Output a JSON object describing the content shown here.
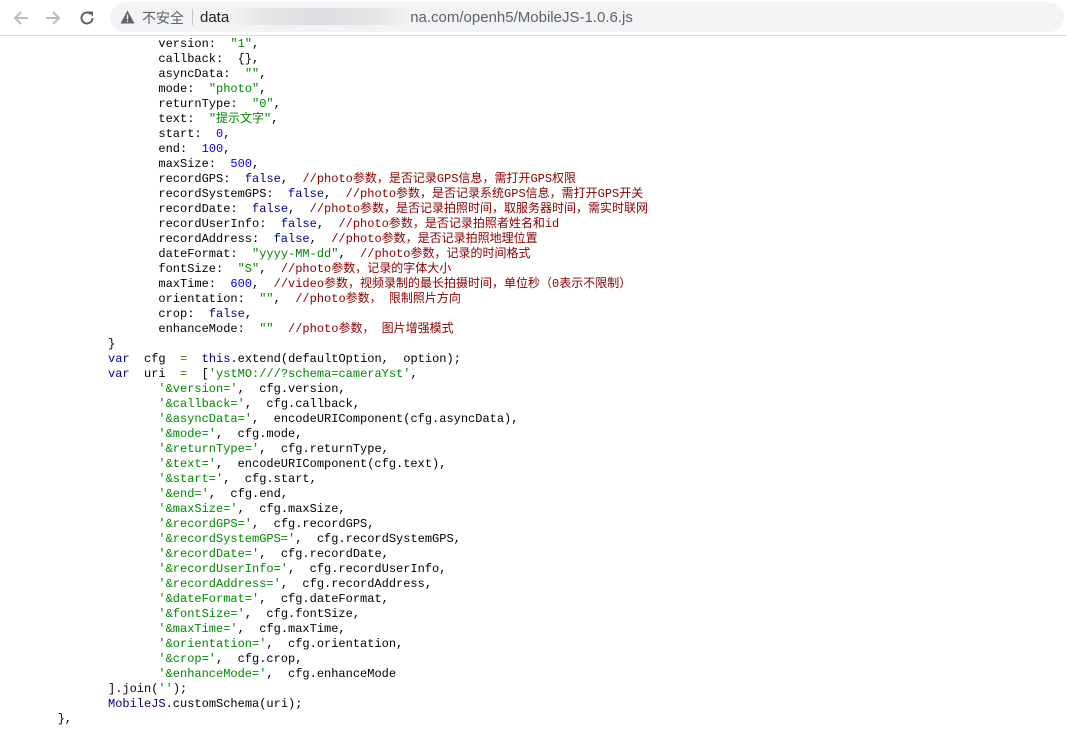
{
  "browser": {
    "security_label": "不安全",
    "url_prefix": "data",
    "url_suffix": "na.com/openh5/MobileJS-1.0.6.js"
  },
  "code_lines": [
    {
      "indent": 22,
      "tokens": [
        {
          "t": "p",
          "v": "version:  "
        },
        {
          "t": "s",
          "v": "\"1\""
        },
        {
          "t": "p",
          "v": ","
        }
      ]
    },
    {
      "indent": 22,
      "tokens": [
        {
          "t": "p",
          "v": "callback:  {},"
        }
      ]
    },
    {
      "indent": 22,
      "tokens": [
        {
          "t": "p",
          "v": "asyncData:  "
        },
        {
          "t": "s",
          "v": "\"\""
        },
        {
          "t": "p",
          "v": ","
        }
      ]
    },
    {
      "indent": 22,
      "tokens": [
        {
          "t": "p",
          "v": "mode:  "
        },
        {
          "t": "s",
          "v": "\"photo\""
        },
        {
          "t": "p",
          "v": ","
        }
      ]
    },
    {
      "indent": 22,
      "tokens": [
        {
          "t": "p",
          "v": "returnType:  "
        },
        {
          "t": "s",
          "v": "\"0\""
        },
        {
          "t": "p",
          "v": ","
        }
      ]
    },
    {
      "indent": 22,
      "tokens": [
        {
          "t": "p",
          "v": "text:  "
        },
        {
          "t": "s",
          "v": "\"提示文字\""
        },
        {
          "t": "p",
          "v": ","
        }
      ]
    },
    {
      "indent": 22,
      "tokens": [
        {
          "t": "p",
          "v": "start:  "
        },
        {
          "t": "n",
          "v": "0"
        },
        {
          "t": "p",
          "v": ","
        }
      ]
    },
    {
      "indent": 22,
      "tokens": [
        {
          "t": "p",
          "v": "end:  "
        },
        {
          "t": "n",
          "v": "100"
        },
        {
          "t": "p",
          "v": ","
        }
      ]
    },
    {
      "indent": 22,
      "tokens": [
        {
          "t": "p",
          "v": "maxSize:  "
        },
        {
          "t": "n",
          "v": "500"
        },
        {
          "t": "p",
          "v": ","
        }
      ]
    },
    {
      "indent": 22,
      "tokens": [
        {
          "t": "p",
          "v": "recordGPS:  "
        },
        {
          "t": "k",
          "v": "false"
        },
        {
          "t": "p",
          "v": ",  "
        },
        {
          "t": "c",
          "v": "//photo参数，是否记录GPS信息，需打开GPS权限"
        }
      ]
    },
    {
      "indent": 22,
      "tokens": [
        {
          "t": "p",
          "v": "recordSystemGPS:  "
        },
        {
          "t": "k",
          "v": "false"
        },
        {
          "t": "p",
          "v": ",  "
        },
        {
          "t": "c",
          "v": "//photo参数，是否记录系统GPS信息，需打开GPS开关"
        }
      ]
    },
    {
      "indent": 22,
      "tokens": [
        {
          "t": "p",
          "v": "recordDate:  "
        },
        {
          "t": "k",
          "v": "false"
        },
        {
          "t": "p",
          "v": ",  "
        },
        {
          "t": "c",
          "v": "//photo参数，是否记录拍照时间，取服务器时间，需实时联网"
        }
      ]
    },
    {
      "indent": 22,
      "tokens": [
        {
          "t": "p",
          "v": "recordUserInfo:  "
        },
        {
          "t": "k",
          "v": "false"
        },
        {
          "t": "p",
          "v": ",  "
        },
        {
          "t": "c",
          "v": "//photo参数，是否记录拍照者姓名和id"
        }
      ]
    },
    {
      "indent": 22,
      "tokens": [
        {
          "t": "p",
          "v": "recordAddress:  "
        },
        {
          "t": "k",
          "v": "false"
        },
        {
          "t": "p",
          "v": ",  "
        },
        {
          "t": "c",
          "v": "//photo参数，是否记录拍照地理位置"
        }
      ]
    },
    {
      "indent": 22,
      "tokens": [
        {
          "t": "p",
          "v": "dateFormat:  "
        },
        {
          "t": "s",
          "v": "\"yyyy-MM-dd\""
        },
        {
          "t": "p",
          "v": ",  "
        },
        {
          "t": "c",
          "v": "//photo参数，记录的时间格式"
        }
      ]
    },
    {
      "indent": 22,
      "tokens": [
        {
          "t": "p",
          "v": "fontSize:  "
        },
        {
          "t": "s",
          "v": "\"S\""
        },
        {
          "t": "p",
          "v": ",  "
        },
        {
          "t": "c",
          "v": "//photo参数，记录的字体大小"
        }
      ]
    },
    {
      "indent": 22,
      "tokens": [
        {
          "t": "p",
          "v": "maxTime:  "
        },
        {
          "t": "n",
          "v": "600"
        },
        {
          "t": "p",
          "v": ",  "
        },
        {
          "t": "c",
          "v": "//video参数，视频录制的最长拍摄时间，单位秒（0表示不限制）"
        }
      ]
    },
    {
      "indent": 22,
      "tokens": [
        {
          "t": "p",
          "v": "orientation:  "
        },
        {
          "t": "s",
          "v": "\"\""
        },
        {
          "t": "p",
          "v": ",  "
        },
        {
          "t": "c",
          "v": "//photo参数， 限制照片方向"
        }
      ]
    },
    {
      "indent": 22,
      "tokens": [
        {
          "t": "p",
          "v": "crop:  "
        },
        {
          "t": "k",
          "v": "false"
        },
        {
          "t": "p",
          "v": ","
        }
      ]
    },
    {
      "indent": 22,
      "tokens": [
        {
          "t": "p",
          "v": "enhanceMode:  "
        },
        {
          "t": "s",
          "v": "\"\""
        },
        {
          "t": "p",
          "v": "  "
        },
        {
          "t": "c",
          "v": "//photo参数， 图片增强模式"
        }
      ]
    },
    {
      "indent": 15,
      "tokens": [
        {
          "t": "p",
          "v": "}"
        }
      ]
    },
    {
      "indent": 15,
      "tokens": [
        {
          "t": "k",
          "v": "var"
        },
        {
          "t": "p",
          "v": "  cfg  "
        },
        {
          "t": "o",
          "v": "="
        },
        {
          "t": "p",
          "v": "  "
        },
        {
          "t": "k",
          "v": "this"
        },
        {
          "t": "p",
          "v": ".extend(defaultOption,  option);"
        }
      ]
    },
    {
      "indent": 15,
      "tokens": [
        {
          "t": "k",
          "v": "var"
        },
        {
          "t": "p",
          "v": "  uri  "
        },
        {
          "t": "o",
          "v": "="
        },
        {
          "t": "p",
          "v": "  ["
        },
        {
          "t": "s",
          "v": "'ystMO:///?schema=cameraYst'"
        },
        {
          "t": "p",
          "v": ","
        }
      ]
    },
    {
      "indent": 22,
      "tokens": [
        {
          "t": "s",
          "v": "'&version='"
        },
        {
          "t": "p",
          "v": ",  cfg.version,"
        }
      ]
    },
    {
      "indent": 22,
      "tokens": [
        {
          "t": "s",
          "v": "'&callback='"
        },
        {
          "t": "p",
          "v": ",  cfg.callback,"
        }
      ]
    },
    {
      "indent": 22,
      "tokens": [
        {
          "t": "s",
          "v": "'&asyncData='"
        },
        {
          "t": "p",
          "v": ",  encodeURIComponent(cfg.asyncData),"
        }
      ]
    },
    {
      "indent": 22,
      "tokens": [
        {
          "t": "s",
          "v": "'&mode='"
        },
        {
          "t": "p",
          "v": ",  cfg.mode,"
        }
      ]
    },
    {
      "indent": 22,
      "tokens": [
        {
          "t": "s",
          "v": "'&returnType='"
        },
        {
          "t": "p",
          "v": ",  cfg.returnType,"
        }
      ]
    },
    {
      "indent": 22,
      "tokens": [
        {
          "t": "s",
          "v": "'&text='"
        },
        {
          "t": "p",
          "v": ",  encodeURIComponent(cfg.text),"
        }
      ]
    },
    {
      "indent": 22,
      "tokens": [
        {
          "t": "s",
          "v": "'&start='"
        },
        {
          "t": "p",
          "v": ",  cfg.start,"
        }
      ]
    },
    {
      "indent": 22,
      "tokens": [
        {
          "t": "s",
          "v": "'&end='"
        },
        {
          "t": "p",
          "v": ",  cfg.end,"
        }
      ]
    },
    {
      "indent": 22,
      "tokens": [
        {
          "t": "s",
          "v": "'&maxSize='"
        },
        {
          "t": "p",
          "v": ",  cfg.maxSize,"
        }
      ]
    },
    {
      "indent": 22,
      "tokens": [
        {
          "t": "s",
          "v": "'&recordGPS='"
        },
        {
          "t": "p",
          "v": ",  cfg.recordGPS,"
        }
      ]
    },
    {
      "indent": 22,
      "tokens": [
        {
          "t": "s",
          "v": "'&recordSystemGPS='"
        },
        {
          "t": "p",
          "v": ",  cfg.recordSystemGPS,"
        }
      ]
    },
    {
      "indent": 22,
      "tokens": [
        {
          "t": "s",
          "v": "'&recordDate='"
        },
        {
          "t": "p",
          "v": ",  cfg.recordDate,"
        }
      ]
    },
    {
      "indent": 22,
      "tokens": [
        {
          "t": "s",
          "v": "'&recordUserInfo='"
        },
        {
          "t": "p",
          "v": ",  cfg.recordUserInfo,"
        }
      ]
    },
    {
      "indent": 22,
      "tokens": [
        {
          "t": "s",
          "v": "'&recordAddress='"
        },
        {
          "t": "p",
          "v": ",  cfg.recordAddress,"
        }
      ]
    },
    {
      "indent": 22,
      "tokens": [
        {
          "t": "s",
          "v": "'&dateFormat='"
        },
        {
          "t": "p",
          "v": ",  cfg.dateFormat,"
        }
      ]
    },
    {
      "indent": 22,
      "tokens": [
        {
          "t": "s",
          "v": "'&fontSize='"
        },
        {
          "t": "p",
          "v": ",  cfg.fontSize,"
        }
      ]
    },
    {
      "indent": 22,
      "tokens": [
        {
          "t": "s",
          "v": "'&maxTime='"
        },
        {
          "t": "p",
          "v": ",  cfg.maxTime,"
        }
      ]
    },
    {
      "indent": 22,
      "tokens": [
        {
          "t": "s",
          "v": "'&orientation='"
        },
        {
          "t": "p",
          "v": ",  cfg.orientation,"
        }
      ]
    },
    {
      "indent": 22,
      "tokens": [
        {
          "t": "s",
          "v": "'&crop='"
        },
        {
          "t": "p",
          "v": ",  cfg.crop,"
        }
      ]
    },
    {
      "indent": 22,
      "tokens": [
        {
          "t": "s",
          "v": "'&enhanceMode='"
        },
        {
          "t": "p",
          "v": ",  cfg.enhanceMode"
        }
      ]
    },
    {
      "indent": 15,
      "tokens": [
        {
          "t": "p",
          "v": "].join("
        },
        {
          "t": "s",
          "v": "''"
        },
        {
          "t": "p",
          "v": ");"
        }
      ]
    },
    {
      "indent": 15,
      "tokens": [
        {
          "t": "k",
          "v": "MobileJS"
        },
        {
          "t": "p",
          "v": ".customSchema(uri);"
        }
      ]
    },
    {
      "indent": 8,
      "tokens": [
        {
          "t": "p",
          "v": "},"
        }
      ]
    }
  ]
}
